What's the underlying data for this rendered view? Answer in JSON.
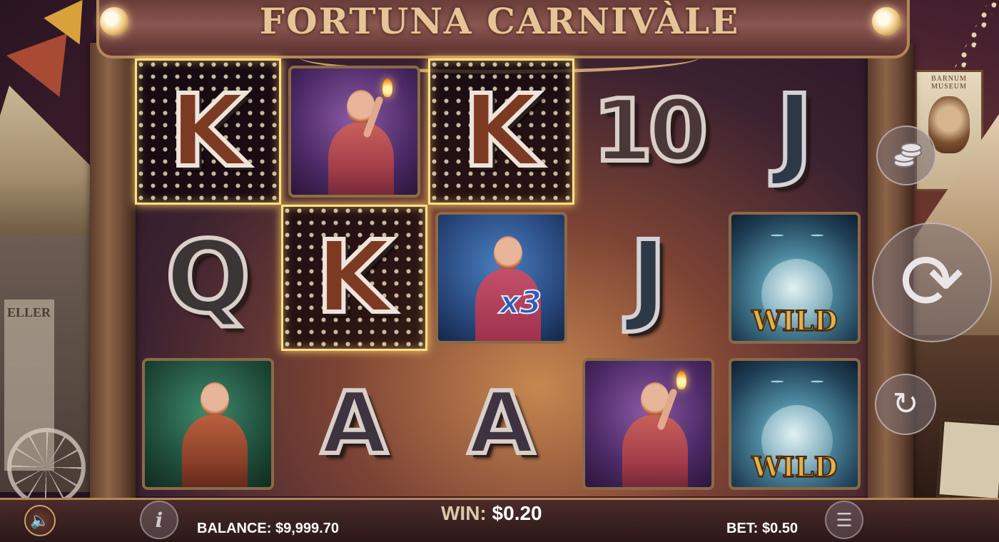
{
  "game": {
    "title": "FORTUNA CARNIVÀLE"
  },
  "scenery": {
    "left_sign": "ELLER",
    "poster_title": "BARNUM MUSEUM"
  },
  "reels": {
    "columns": 5,
    "rows": 3,
    "grid": [
      [
        {
          "symbol": "K",
          "type": "letter",
          "winning": true
        },
        {
          "symbol": "Q",
          "type": "letter",
          "winning": false
        },
        {
          "symbol": "Knife Juggler",
          "type": "portrait",
          "winning": false
        }
      ],
      [
        {
          "symbol": "Fire Dancer",
          "type": "portrait",
          "winning": false
        },
        {
          "symbol": "K",
          "type": "letter",
          "winning": true
        },
        {
          "symbol": "A",
          "type": "letter",
          "winning": false
        }
      ],
      [
        {
          "symbol": "K",
          "type": "letter",
          "winning": true
        },
        {
          "symbol": "Acrobat",
          "type": "portrait",
          "multiplier": "x3",
          "winning": false
        },
        {
          "symbol": "A",
          "type": "letter",
          "winning": false
        }
      ],
      [
        {
          "symbol": "10",
          "type": "letter",
          "winning": false
        },
        {
          "symbol": "J",
          "type": "letter",
          "winning": false
        },
        {
          "symbol": "Fire Dancer",
          "type": "portrait",
          "winning": false
        }
      ],
      [
        {
          "symbol": "J",
          "type": "letter",
          "winning": false
        },
        {
          "symbol": "WILD",
          "type": "wild",
          "label": "WILD",
          "winning": false
        },
        {
          "symbol": "WILD",
          "type": "wild",
          "label": "WILD",
          "winning": false
        }
      ]
    ]
  },
  "status": {
    "balance_label": "BALANCE:",
    "balance_value": "$9,999.70",
    "win_label": "WIN:",
    "win_value": "$0.20",
    "bet_label": "BET:",
    "bet_value": "$0.50"
  },
  "controls": {
    "sound_icon": "speaker-icon",
    "info_icon": "info-icon",
    "info_glyph": "i",
    "menu_icon": "hamburger-menu-icon",
    "coins_icon": "coins-stack-icon",
    "spin_icon": "spin-arrows-icon",
    "autoplay_icon": "autoplay-icon"
  },
  "colors": {
    "win_highlight": "#ffe08a",
    "frame_gold": "#b48657",
    "text_white": "#ffffff"
  }
}
